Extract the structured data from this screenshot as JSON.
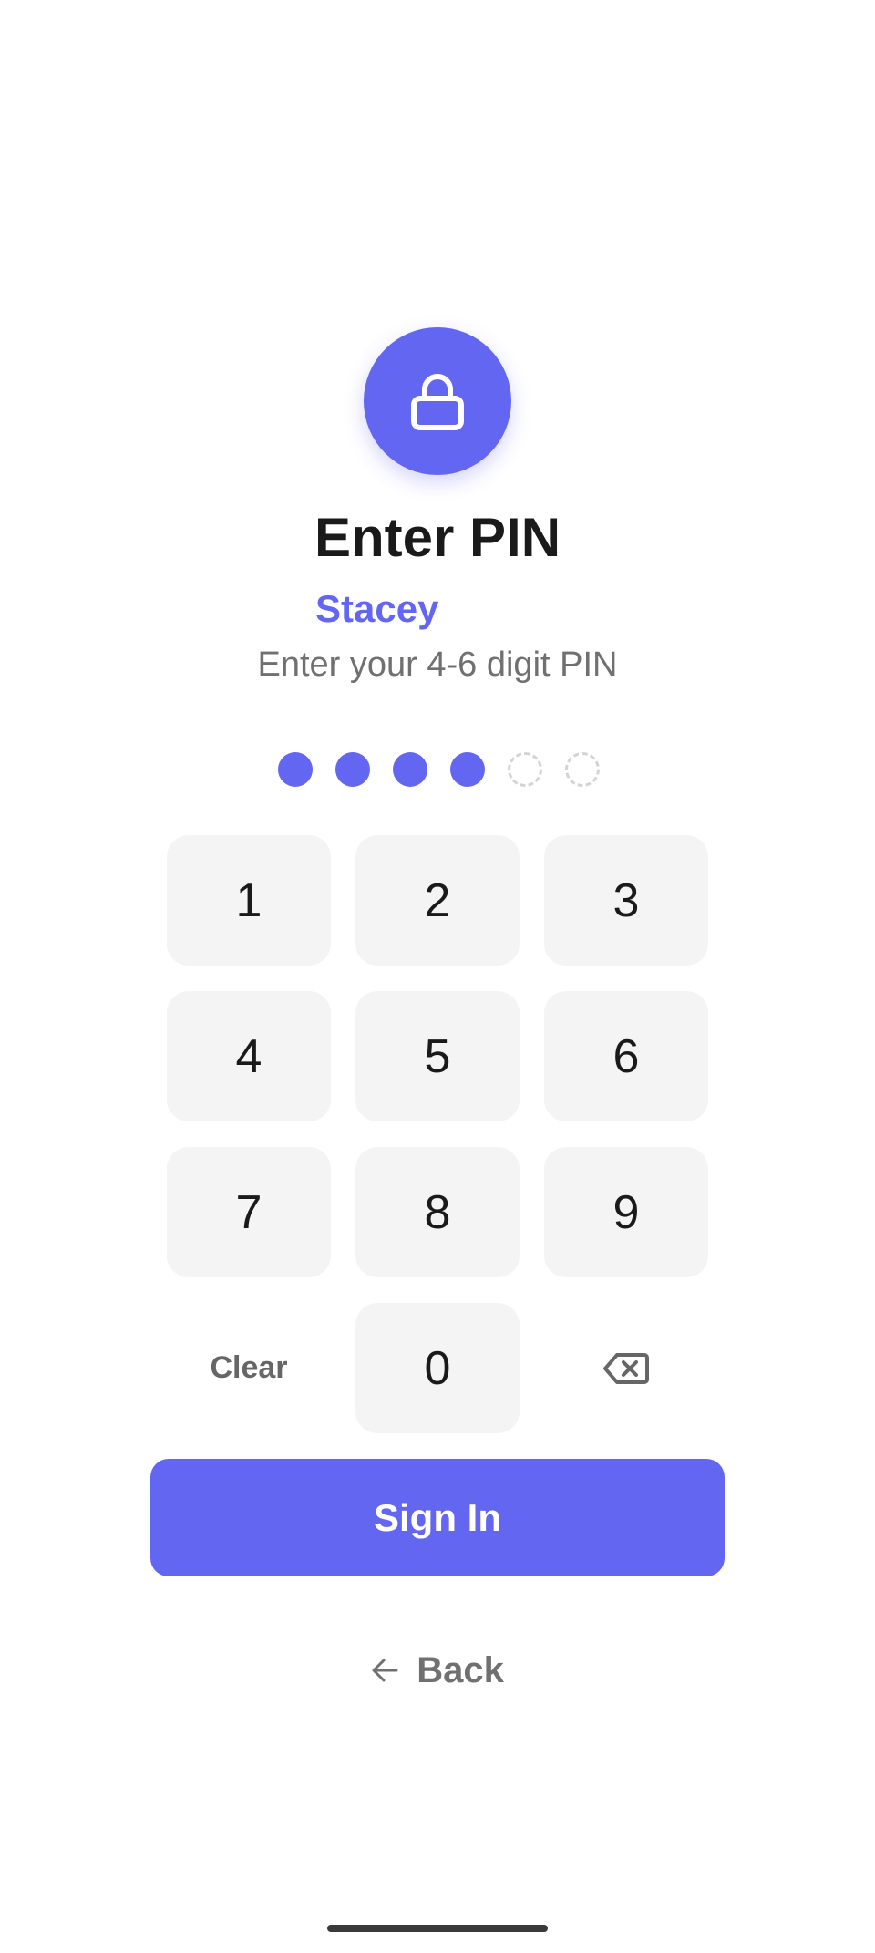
{
  "colors": {
    "accent": "#6366F1",
    "text_primary": "#1A1A1A",
    "text_secondary": "#707070",
    "key_background": "#F4F4F4",
    "dot_empty": "#D4D4D4"
  },
  "header": {
    "icon": "lock-icon",
    "title": "Enter PIN",
    "user_name": "Stacey",
    "subtitle": "Enter your 4-6 digit PIN"
  },
  "pin": {
    "filled": 4,
    "max_length": 6
  },
  "keypad": {
    "keys": [
      "1",
      "2",
      "3",
      "4",
      "5",
      "6",
      "7",
      "8",
      "9"
    ],
    "clear_label": "Clear",
    "zero_label": "0",
    "backspace_icon": "backspace-icon"
  },
  "actions": {
    "sign_in_label": "Sign In",
    "back_label": "Back",
    "back_icon": "arrow-left-icon"
  }
}
